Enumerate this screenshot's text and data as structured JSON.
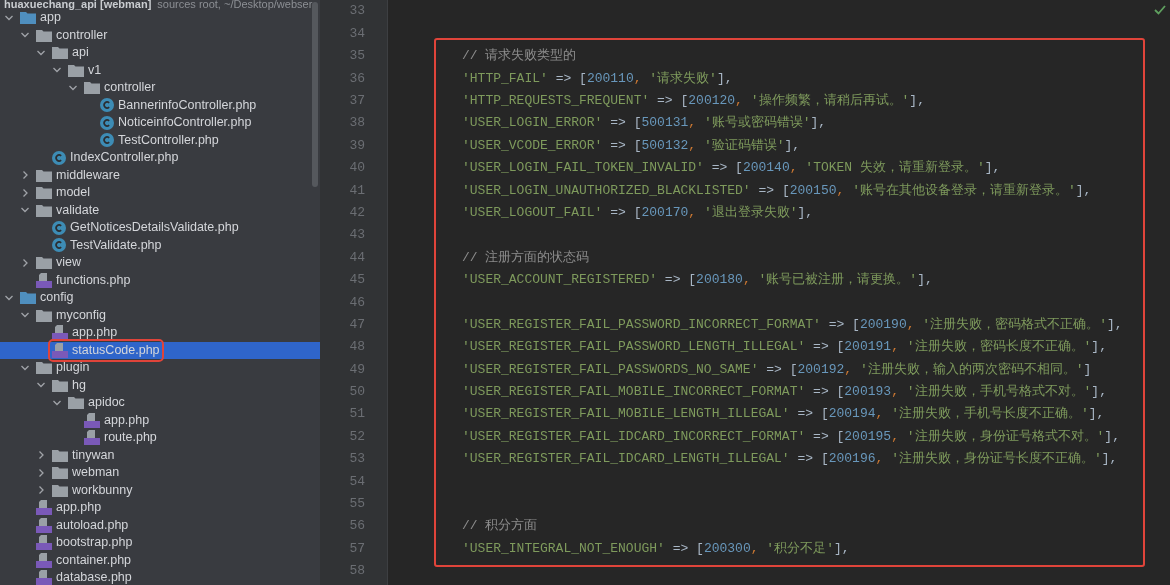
{
  "project_header": {
    "name": "huaxuechang_api [webman]",
    "info": "sources root, ~/Desktop/webser"
  },
  "tree": [
    {
      "name": "app",
      "kind": "folder",
      "expanded": true,
      "selected": false,
      "children": [
        {
          "name": "controller",
          "kind": "folder",
          "expanded": true,
          "selected": false,
          "children": [
            {
              "name": "api",
              "kind": "folder",
              "expanded": true,
              "selected": false,
              "children": [
                {
                  "name": "v1",
                  "kind": "folder",
                  "expanded": true,
                  "selected": false,
                  "children": [
                    {
                      "name": "controller",
                      "kind": "folder",
                      "expanded": true,
                      "selected": false,
                      "children": [
                        {
                          "name": "BannerinfoController.php",
                          "kind": "class",
                          "selected": false
                        },
                        {
                          "name": "NoticeinfoController.php",
                          "kind": "class",
                          "selected": false
                        },
                        {
                          "name": "TestController.php",
                          "kind": "class",
                          "selected": false
                        }
                      ]
                    }
                  ]
                }
              ]
            },
            {
              "name": "IndexController.php",
              "kind": "class",
              "selected": false
            }
          ]
        },
        {
          "name": "middleware",
          "kind": "folder",
          "expanded": false,
          "selected": false
        },
        {
          "name": "model",
          "kind": "folder",
          "expanded": false,
          "selected": false
        },
        {
          "name": "validate",
          "kind": "folder",
          "expanded": true,
          "selected": false,
          "children": [
            {
              "name": "GetNoticesDetailsValidate.php",
              "kind": "class",
              "selected": false
            },
            {
              "name": "TestValidate.php",
              "kind": "class",
              "selected": false
            }
          ]
        },
        {
          "name": "view",
          "kind": "folder",
          "expanded": false,
          "selected": false
        },
        {
          "name": "functions.php",
          "kind": "php",
          "selected": false
        }
      ]
    },
    {
      "name": "config",
      "kind": "folder",
      "expanded": true,
      "selected": false,
      "children": [
        {
          "name": "myconfig",
          "kind": "folder",
          "expanded": true,
          "selected": false,
          "children": [
            {
              "name": "app.php",
              "kind": "php",
              "selected": false
            },
            {
              "name": "statusCode.php",
              "kind": "php",
              "selected": true
            }
          ]
        },
        {
          "name": "plugin",
          "kind": "folder",
          "expanded": true,
          "selected": false,
          "children": [
            {
              "name": "hg",
              "kind": "folder",
              "expanded": true,
              "selected": false,
              "children": [
                {
                  "name": "apidoc",
                  "kind": "folder",
                  "expanded": true,
                  "selected": false,
                  "children": [
                    {
                      "name": "app.php",
                      "kind": "php",
                      "selected": false
                    },
                    {
                      "name": "route.php",
                      "kind": "php",
                      "selected": false
                    }
                  ]
                }
              ]
            },
            {
              "name": "tinywan",
              "kind": "folder",
              "expanded": false,
              "selected": false
            },
            {
              "name": "webman",
              "kind": "folder",
              "expanded": false,
              "selected": false
            },
            {
              "name": "workbunny",
              "kind": "folder",
              "expanded": false,
              "selected": false
            }
          ]
        },
        {
          "name": "app.php",
          "kind": "php",
          "selected": false
        },
        {
          "name": "autoload.php",
          "kind": "php",
          "selected": false
        },
        {
          "name": "bootstrap.php",
          "kind": "php",
          "selected": false
        },
        {
          "name": "container.php",
          "kind": "php",
          "selected": false
        },
        {
          "name": "database.php",
          "kind": "php",
          "selected": false
        }
      ]
    }
  ],
  "code_lines": [
    {
      "number": "33",
      "kind": "blank"
    },
    {
      "number": "34",
      "kind": "blank"
    },
    {
      "number": "35",
      "kind": "comment",
      "text": "// 请求失败类型的"
    },
    {
      "number": "36",
      "kind": "entry",
      "key": "'HTTP_FAIL'",
      "arrow": "=>",
      "open": "[",
      "code": "200110",
      "comma": ",",
      "message": "'请求失败'",
      "close": "],"
    },
    {
      "number": "37",
      "kind": "entry",
      "key": "'HTTP_REQUESTS_FREQUENT'",
      "arrow": "=>",
      "open": "[",
      "code": "200120",
      "comma": ",",
      "message": "'操作频繁，请稍后再试。'",
      "close": "],"
    },
    {
      "number": "38",
      "kind": "entry",
      "key": "'USER_LOGIN_ERROR'",
      "arrow": "=>",
      "open": "[",
      "code": "500131",
      "comma": ",",
      "message": "'账号或密码错误'",
      "close": "],"
    },
    {
      "number": "39",
      "kind": "entry",
      "key": "'USER_VCODE_ERROR'",
      "arrow": "=>",
      "open": "[",
      "code": "500132",
      "comma": ",",
      "message": "'验证码错误'",
      "close": "],"
    },
    {
      "number": "40",
      "kind": "entry",
      "key": "'USER_LOGIN_FAIL_TOKEN_INVALID'",
      "arrow": "=>",
      "open": "[",
      "code": "200140",
      "comma": ",",
      "message": "'TOKEN 失效，请重新登录。'",
      "close": "],"
    },
    {
      "number": "41",
      "kind": "entry",
      "key": "'USER_LOGIN_UNAUTHORIZED_BLACKLISTED'",
      "arrow": "=>",
      "open": "[",
      "code": "200150",
      "comma": ",",
      "message": "'账号在其他设备登录，请重新登录。'",
      "close": "],"
    },
    {
      "number": "42",
      "kind": "entry",
      "key": "'USER_LOGOUT_FAIL'",
      "arrow": "=>",
      "open": "[",
      "code": "200170",
      "comma": ",",
      "message": "'退出登录失败'",
      "close": "],"
    },
    {
      "number": "43",
      "kind": "blank"
    },
    {
      "number": "44",
      "kind": "comment",
      "text": "// 注册方面的状态码"
    },
    {
      "number": "45",
      "kind": "entry",
      "key": "'USER_ACCOUNT_REGISTERED'",
      "arrow": "=>",
      "open": "[",
      "code": "200180",
      "comma": ",",
      "message": "'账号已被注册，请更换。'",
      "close": "],"
    },
    {
      "number": "46",
      "kind": "blank"
    },
    {
      "number": "47",
      "kind": "entry",
      "key": "'USER_REGISTER_FAIL_PASSWORD_INCORRECT_FORMAT'",
      "arrow": "=>",
      "open": "[",
      "code": "200190",
      "comma": ",",
      "message": "'注册失败，密码格式不正确。'",
      "close": "],"
    },
    {
      "number": "48",
      "kind": "entry",
      "key": "'USER_REGISTER_FAIL_PASSWORD_LENGTH_ILLEGAL'",
      "arrow": "=>",
      "open": "[",
      "code": "200191",
      "comma": ",",
      "message": "'注册失败，密码长度不正确。'",
      "close": "],"
    },
    {
      "number": "49",
      "kind": "entry",
      "key": "'USER_REGISTER_FAIL_PASSWORDS_NO_SAME'",
      "arrow": "=>",
      "open": "[",
      "code": "200192",
      "comma": ",",
      "message": "'注册失败，输入的两次密码不相同。'",
      "close": "]"
    },
    {
      "number": "50",
      "kind": "entry",
      "key": "'USER_REGISTER_FAIL_MOBILE_INCORRECT_FORMAT'",
      "arrow": "=>",
      "open": "[",
      "code": "200193",
      "comma": ",",
      "message": "'注册失败，手机号格式不对。'",
      "close": "],"
    },
    {
      "number": "51",
      "kind": "entry",
      "key": "'USER_REGISTER_FAIL_MOBILE_LENGTH_ILLEGAL'",
      "arrow": "=>",
      "open": "[",
      "code": "200194",
      "comma": ",",
      "message": "'注册失败，手机号长度不正确。'",
      "close": "],"
    },
    {
      "number": "52",
      "kind": "entry",
      "key": "'USER_REGISTER_FAIL_IDCARD_INCORRECT_FORMAT'",
      "arrow": "=>",
      "open": "[",
      "code": "200195",
      "comma": ",",
      "message": "'注册失败，身份证号格式不对。'",
      "close": "],"
    },
    {
      "number": "53",
      "kind": "entry",
      "key": "'USER_REGISTER_FAIL_IDCARD_LENGTH_ILLEGAL'",
      "arrow": "=>",
      "open": "[",
      "code": "200196",
      "comma": ",",
      "message": "'注册失败，身份证号长度不正确。'",
      "close": "],"
    },
    {
      "number": "54",
      "kind": "blank"
    },
    {
      "number": "55",
      "kind": "blank"
    },
    {
      "number": "56",
      "kind": "comment",
      "text": "// 积分方面"
    },
    {
      "number": "57",
      "kind": "entry",
      "key": "'USER_INTEGRAL_NOT_ENOUGH'",
      "arrow": "=>",
      "open": "[",
      "code": "200300",
      "comma": ",",
      "message": "'积分不足'",
      "close": "],"
    },
    {
      "number": "58",
      "kind": "blank"
    }
  ]
}
